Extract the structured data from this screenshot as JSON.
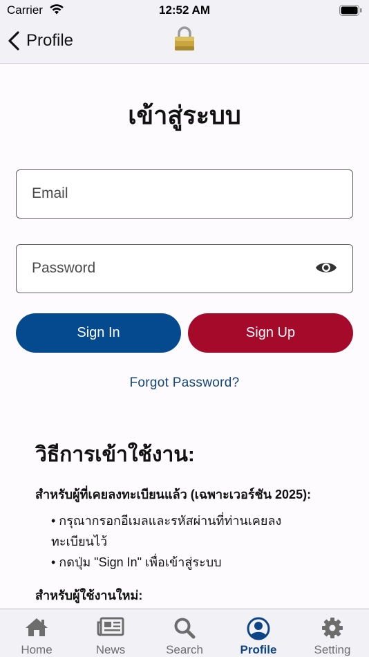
{
  "status_bar": {
    "carrier": "Carrier",
    "time": "12:52 AM"
  },
  "nav": {
    "back_label": "Profile",
    "center_icon": "lock-icon"
  },
  "login": {
    "title": "เข้าสู่ระบบ",
    "email_placeholder": "Email",
    "password_placeholder": "Password",
    "sign_in_label": "Sign In",
    "sign_up_label": "Sign Up",
    "forgot_label": "Forgot Password?"
  },
  "instructions": {
    "title": "วิธีการเข้าใช้งาน:",
    "existing_heading": "สำหรับผู้ที่เคยลงทะเบียนแล้ว (เฉพาะเวอร์ชัน 2025):",
    "existing_line1": "• กรุณากรอกอีเมลและรหัสผ่านที่ท่านเคยลง",
    "existing_line2": "ทะเบียนไว้",
    "existing_line3": "• กดปุ่ม \"Sign In\" เพื่อเข้าสู่ระบบ",
    "new_heading": "สำหรับผู้ใช้งานใหม่:"
  },
  "tabs": [
    {
      "label": "Home",
      "icon": "home-icon"
    },
    {
      "label": "News",
      "icon": "newspaper-icon"
    },
    {
      "label": "Search",
      "icon": "search-icon"
    },
    {
      "label": "Profile",
      "icon": "profile-icon"
    },
    {
      "label": "Setting",
      "icon": "gear-icon"
    }
  ],
  "colors": {
    "sign_in": "#05498f",
    "sign_up": "#a60a2b",
    "active_tab": "#0b4585",
    "link": "#10457d"
  }
}
